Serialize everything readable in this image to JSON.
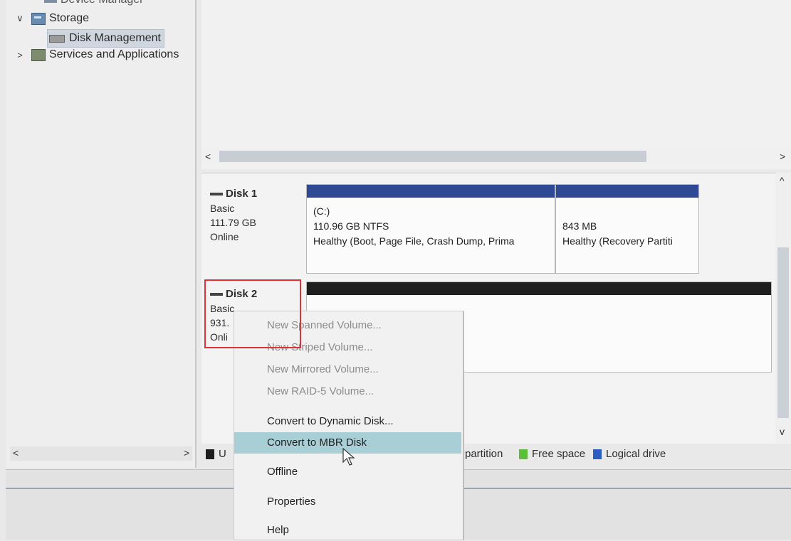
{
  "tree": {
    "items": [
      {
        "label": "Device Manager",
        "truncated": true
      },
      {
        "label": "Storage",
        "expanded": true
      },
      {
        "label": "Disk Management",
        "selected": true
      },
      {
        "label": "Services and Applications",
        "expanded": false
      }
    ]
  },
  "scroll": {
    "left_arrow": "<",
    "right_arrow": ">",
    "up_arrow": "^",
    "down_arrow": "v"
  },
  "disks": [
    {
      "name": "Disk 1",
      "type": "Basic",
      "size": "111.79 GB",
      "status": "Online",
      "partitions": [
        {
          "label": "(C:)",
          "size": "110.96 GB NTFS",
          "status": "Healthy (Boot, Page File, Crash Dump, Prima",
          "bar_color": "#2f4a94"
        },
        {
          "label": "",
          "size": "843 MB",
          "status": "Healthy (Recovery Partiti",
          "bar_color": "#2f4a94"
        }
      ]
    },
    {
      "name": "Disk 2",
      "type": "Basic",
      "size": "931.",
      "status": "Onli",
      "partitions": [
        {
          "label": "",
          "size": "",
          "status": "",
          "bar_color": "#1e1e1e"
        }
      ]
    }
  ],
  "legend": {
    "items": [
      {
        "label": "U",
        "color": "#1e1e1e"
      },
      {
        "label": "partition",
        "color": "#2f4a94"
      },
      {
        "label": "Free space",
        "color": "#5bbf3a"
      },
      {
        "label": "Logical drive",
        "color": "#2d5cc4"
      }
    ]
  },
  "context_menu": {
    "items": [
      {
        "label": "New Spanned Volume...",
        "enabled": false
      },
      {
        "label": "New Striped Volume...",
        "enabled": false
      },
      {
        "label": "New Mirrored Volume...",
        "enabled": false
      },
      {
        "label": "New RAID-5 Volume...",
        "enabled": false
      },
      {
        "label": "Convert to Dynamic Disk...",
        "enabled": true
      },
      {
        "label": "Convert to MBR Disk",
        "enabled": true,
        "hovered": true
      },
      {
        "label": "Offline",
        "enabled": true
      },
      {
        "label": "Properties",
        "enabled": true
      },
      {
        "label": "Help",
        "enabled": true
      }
    ]
  },
  "colors": {
    "basic_partition": "#2f4a94",
    "unallocated": "#1e1e1e",
    "free_space": "#5bbf3a",
    "logical_drive": "#2d5cc4",
    "menu_hover": "#a9cfd6",
    "highlight_box": "#e0303a"
  }
}
